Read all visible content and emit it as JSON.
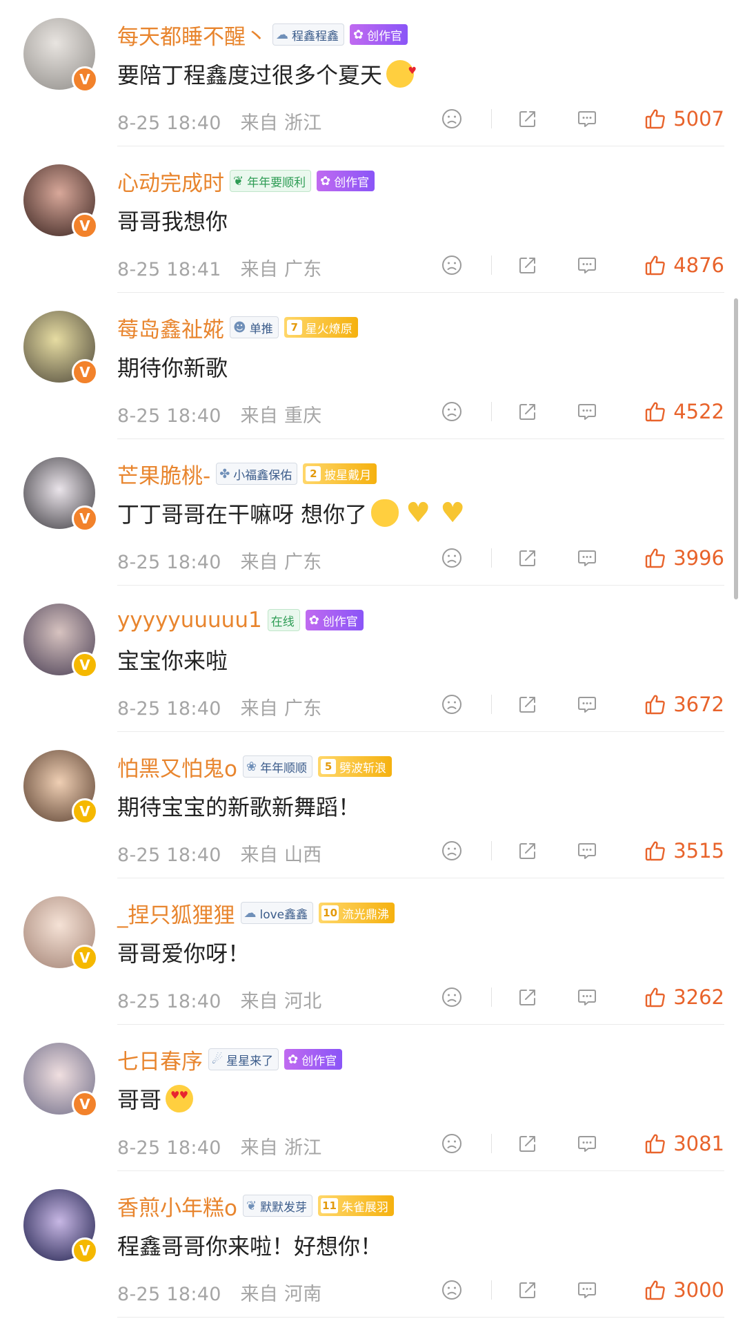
{
  "accent_color": "#e8632b",
  "username_color": "#e8852e",
  "comments": [
    {
      "username": "每天都睡不醒丶",
      "tags": [
        {
          "icon": "cloud-icon",
          "text": "程鑫程鑫",
          "style": "plain"
        },
        {
          "icon": "creator-icon",
          "text": "创作官",
          "style": "purple"
        }
      ],
      "verified": "orange",
      "text": "要陪丁程鑫度过很多个夏天",
      "emojis": [
        "kiss-emoji"
      ],
      "date": "8-25 18:40",
      "from": "来自",
      "location": "浙江",
      "likes": "5007"
    },
    {
      "username": "心动完成时",
      "tags": [
        {
          "icon": "sprout-icon",
          "text": "年年要顺利",
          "style": "green"
        },
        {
          "icon": "creator-icon",
          "text": "创作官",
          "style": "purple"
        }
      ],
      "verified": "orange",
      "text": "哥哥我想你",
      "emojis": [],
      "date": "8-25 18:41",
      "from": "来自",
      "location": "广东",
      "likes": "4876"
    },
    {
      "username": "莓岛鑫祉婲",
      "tags": [
        {
          "icon": "user-icon",
          "text": "单推",
          "style": "plain"
        },
        {
          "icon": "level-badge",
          "level": "7",
          "text": "星火燎原",
          "style": "gold"
        }
      ],
      "verified": "orange",
      "text": "期待你新歌",
      "emojis": [],
      "date": "8-25 18:40",
      "from": "来自",
      "location": "重庆",
      "likes": "4522"
    },
    {
      "username": "芒果脆桃-",
      "tags": [
        {
          "icon": "clover-icon",
          "text": "小福鑫保佑",
          "style": "plain"
        },
        {
          "icon": "level-badge",
          "level": "2",
          "text": "披星戴月",
          "style": "gold"
        }
      ],
      "verified": "orange",
      "text": "丁丁哥哥在干嘛呀 想你了",
      "emojis": [
        "cat-kiss-emoji",
        "yellow-heart-emoji",
        "yellow-heart-emoji"
      ],
      "date": "8-25 18:40",
      "from": "来自",
      "location": "广东",
      "likes": "3996"
    },
    {
      "username": "yyyyyuuuuu1",
      "tags": [
        {
          "icon": "",
          "text": "在线",
          "style": "green"
        },
        {
          "icon": "creator-icon",
          "text": "创作官",
          "style": "purple"
        }
      ],
      "verified": "gold",
      "text": "宝宝你来啦",
      "emojis": [],
      "date": "8-25 18:40",
      "from": "来自",
      "location": "广东",
      "likes": "3672"
    },
    {
      "username": "怕黑又怕鬼o",
      "tags": [
        {
          "icon": "lotus-icon",
          "text": "年年顺顺",
          "style": "plain"
        },
        {
          "icon": "level-badge",
          "level": "5",
          "text": "劈波斩浪",
          "style": "gold"
        }
      ],
      "verified": "gold",
      "text": "期待宝宝的新歌新舞蹈！",
      "emojis": [],
      "date": "8-25 18:40",
      "from": "来自",
      "location": "山西",
      "likes": "3515"
    },
    {
      "username": "_捏只狐狸狸",
      "tags": [
        {
          "icon": "cloud-icon",
          "text": "love鑫鑫",
          "style": "plain"
        },
        {
          "icon": "level-badge",
          "level": "10",
          "text": "流光鼎沸",
          "style": "gold"
        }
      ],
      "verified": "gold",
      "text": "哥哥爱你呀！",
      "emojis": [],
      "date": "8-25 18:40",
      "from": "来自",
      "location": "河北",
      "likes": "3262"
    },
    {
      "username": "七日春序",
      "tags": [
        {
          "icon": "astronaut-icon",
          "text": "星星来了",
          "style": "plain"
        },
        {
          "icon": "creator-icon",
          "text": "创作官",
          "style": "purple"
        }
      ],
      "verified": "orange",
      "text": "哥哥",
      "emojis": [
        "heart-eyes-emoji"
      ],
      "date": "8-25 18:40",
      "from": "来自",
      "location": "浙江",
      "likes": "3081"
    },
    {
      "username": "香煎小年糕o",
      "tags": [
        {
          "icon": "sprout-icon",
          "text": "默默发芽",
          "style": "plain"
        },
        {
          "icon": "level-badge",
          "level": "11",
          "text": "朱雀展羽",
          "style": "gold"
        }
      ],
      "verified": "gold",
      "text": "程鑫哥哥你来啦！好想你！",
      "emojis": [],
      "date": "8-25 18:40",
      "from": "来自",
      "location": "河南",
      "likes": "3000"
    }
  ]
}
